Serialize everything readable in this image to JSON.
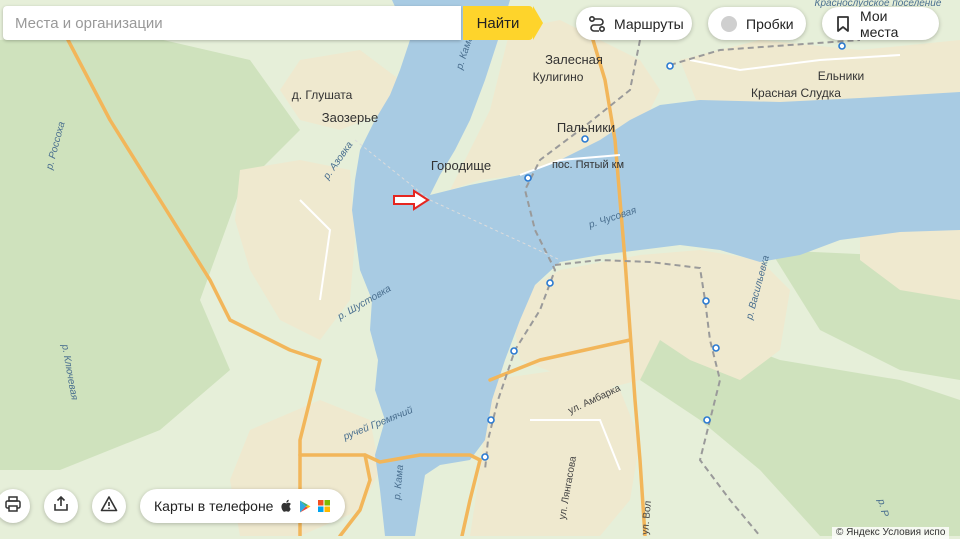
{
  "search": {
    "placeholder": "Места и организации",
    "button": "Найти"
  },
  "controls": {
    "routes": "Маршруты",
    "traffic": "Пробки",
    "my_places": "Мои места",
    "print_icon": "printer-icon",
    "share_icon": "share-icon",
    "report_icon": "warning-icon"
  },
  "mobile_promo": {
    "label": "Карты в телефоне",
    "stores": [
      "apple-icon",
      "google-play-icon",
      "windows-store-icon"
    ]
  },
  "copyright": "© Яндекс Условия испо",
  "colors": {
    "water": "#a8cbe3",
    "land": "#e6efd9",
    "forest": "#cfe2bd",
    "urban": "#efe9cf",
    "highway": "#f2b65a",
    "accent": "#fed42b",
    "marker": "#e52620"
  },
  "map": {
    "places": {
      "zalesnaya": "Залесная",
      "kuligino": "Кулигино",
      "glushata": "д. Глушата",
      "zaozerye": "Заозерье",
      "palniki": "Пальники",
      "gorodishche": "Городище",
      "pyaty_km": "пос. Пятый км",
      "elniki": "Ельники",
      "krasnaya_sludka": "Красная Слудка",
      "krasnosludskoe": "Краснослудское поселение"
    },
    "rivers": {
      "kama_north": "р. Кама",
      "kama_south": "р. Кама",
      "rossoha": "р. Россоха",
      "azovka": "р. Азовка",
      "chusovaya": "р. Чусовая",
      "shustovka": "р. Шустовка",
      "klyuchevaya": "р. Ключевая",
      "vasilyevka": "р. Васильевка",
      "ramenka": "р. Р",
      "gremyachy": "ручей Гремячий"
    },
    "streets": {
      "ambarka": "ул. Амбарка",
      "lyangasova": "ул. Лянгасова",
      "volodarskogo": "ул. Вол"
    }
  }
}
